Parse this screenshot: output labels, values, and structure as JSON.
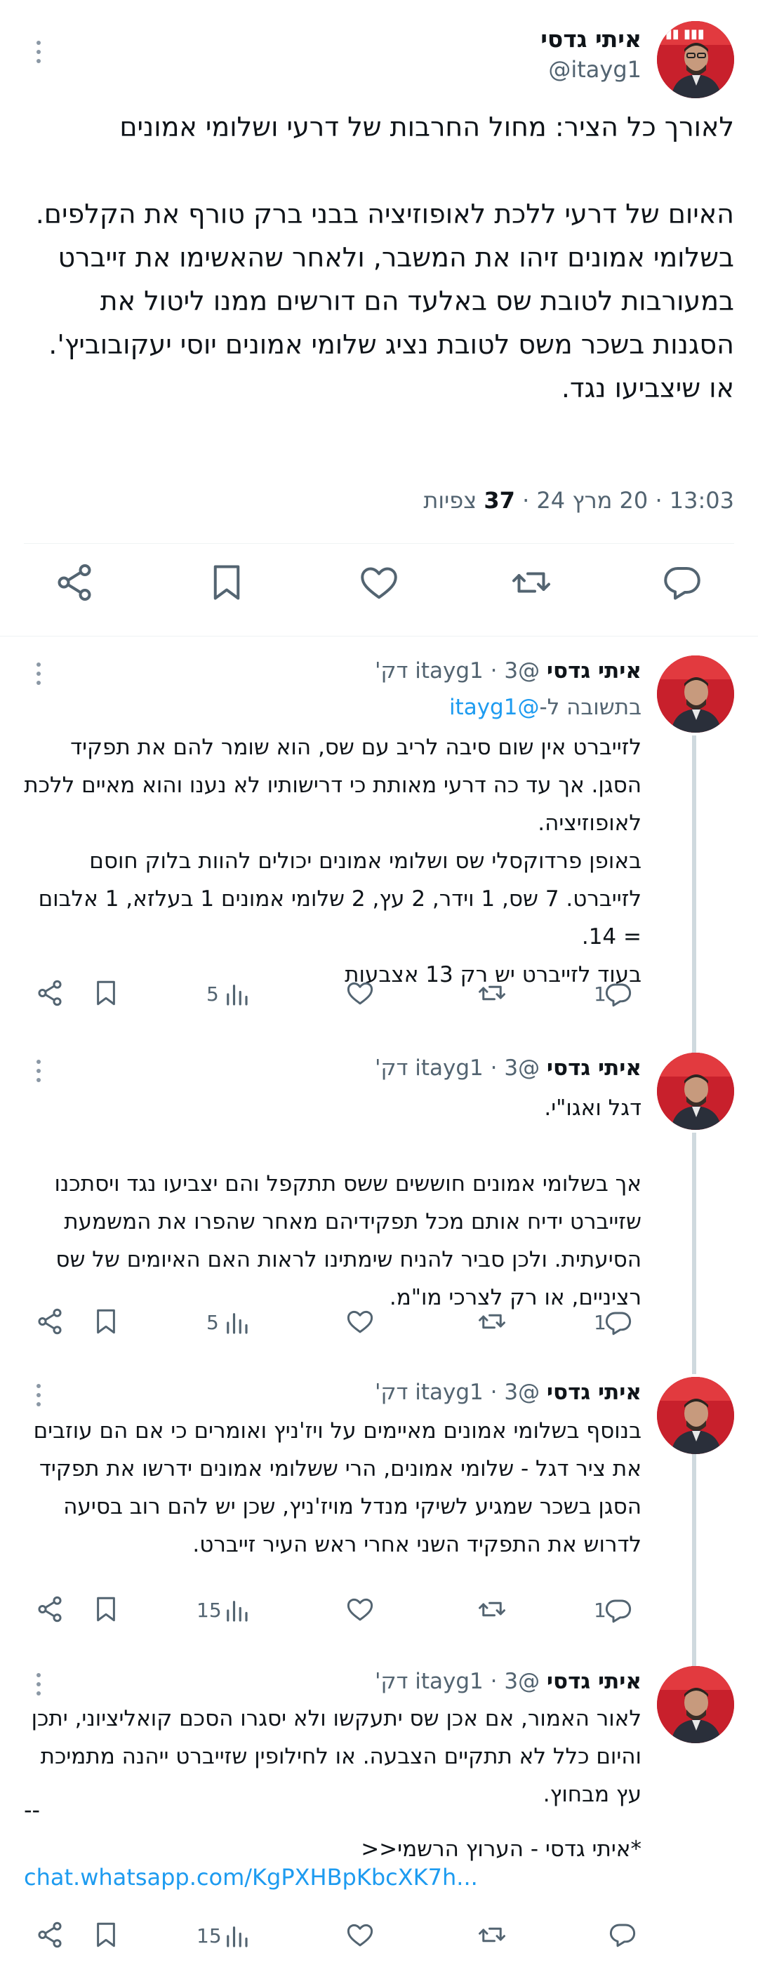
{
  "main_tweet": {
    "author_name": "איתי גדסי",
    "handle": "@itayg1",
    "text": "לאורך כל הציר: מחול החרבות של דרעי ושלומי אמונים\n\nהאיום של דרעי ללכת לאופוזיציה בבני ברק טורף את הקלפים.\nבשלומי אמונים זיהו את המשבר, ולאחר שהאשימו את זייברט במעורבות לטובת שס באלעד הם דורשים ממנו ליטול את הסגנות בשכר משס לטובת נציג שלומי אמונים יוסי יעקובוביץ'. או שיצביעו נגד.",
    "time": "13:03",
    "date": "20 מרץ 24",
    "views_count": "37",
    "views_label": "צפיות",
    "actions": [
      "share-icon",
      "bookmark-icon",
      "like-icon",
      "retweet-icon",
      "reply-icon"
    ]
  },
  "replies": [
    {
      "author_name": "איתי גדסי",
      "handle": "@itayg1",
      "age": "3 דק'",
      "reply_to_label": "בתשובה ל-",
      "reply_to_handle": "@itayg1",
      "text": "לזייברט אין שום סיבה לריב עם שס, הוא שומר להם את תפקיד הסגן. אך עד כה דרעי מאותת כי דרישותיו לא נענו והוא מאיים ללכת לאופוזיציה.\nבאופן פרדוקסלי שס ושלומי אמונים יכולים להוות בלוק חוסם לזייברט. 7 שס, 1 וידר, 2 עץ, 2 שלומי אמונים 1 בעלזא, 1 אלבום = 14.\nבעוד לזייברט יש רק 13 אצבעות",
      "views": "5",
      "replies_count": "1"
    },
    {
      "author_name": "איתי גדסי",
      "handle": "@itayg1",
      "age": "3 דק'",
      "text": "דגל ואגו\"י.\n\nאך בשלומי אמונים חוששים ששס תתקפל והם יצביעו נגד ויסתכנו שזייברט ידיח אותם מכל תפקידיהם מאחר שהפרו את המשמעת הסיעתית. ולכן סביר להניח שימתינו לראות האם האיומים של שס רציניים, או רק לצרכי מו\"מ.",
      "views": "5",
      "replies_count": "1"
    },
    {
      "author_name": "איתי גדסי",
      "handle": "@itayg1",
      "age": "3 דק'",
      "text": "בנוסף בשלומי אמונים מאיימים על ויז'ניץ ואומרים כי אם הם עוזבים את ציר דגל - שלומי אמונים, הרי ששלומי אמונים ידרשו את תפקיד הסגן בשכר שמגיע לשיקי מנדל מויז'ניץ, שכן יש להם רוב בסיעה לדרוש את התפקיד השני אחרי ראש העיר זייברט.",
      "views": "15",
      "replies_count": "1"
    },
    {
      "author_name": "איתי גדסי",
      "handle": "@itayg1",
      "age": "3 דק'",
      "text": "לאור האמור, אם אכן שס יתעקשו ולא יסגרו הסכם קואליציוני, יתכן והיום כלל לא תתקיים הצבעה. או לחילופין שזייברט ייהנה מתמיכת עץ מבחוץ.",
      "separator": "--",
      "signature": "*איתי גדסי - הערוץ הרשמי<<",
      "link": "chat.whatsapp.com/KgPXHBpKbcXK7h...",
      "views": "15",
      "replies_count": ""
    }
  ]
}
